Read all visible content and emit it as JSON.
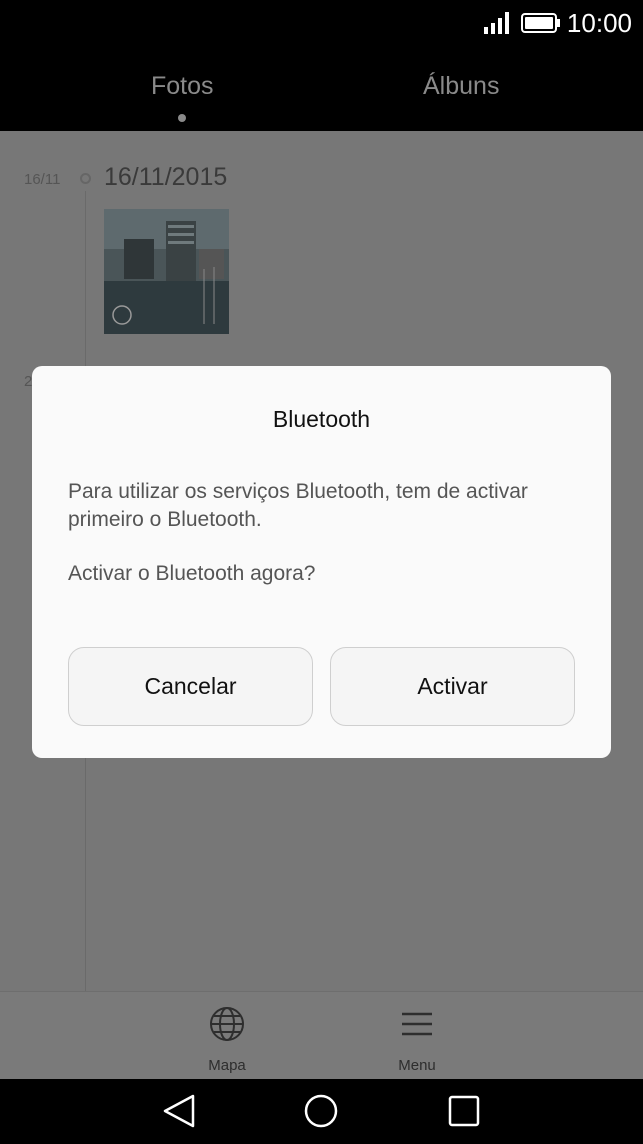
{
  "status_bar": {
    "time": "10:00",
    "icons": [
      "signal-icon",
      "battery-icon"
    ]
  },
  "tabs": [
    {
      "label": "Fotos",
      "selected": true
    },
    {
      "label": "Álbuns",
      "selected": false
    }
  ],
  "timeline": {
    "groups": [
      {
        "short_date": "16/11",
        "long_date": "16/11/2015"
      },
      {
        "short_date": "2"
      }
    ]
  },
  "dialog": {
    "title": "Bluetooth",
    "message": "Para utilizar os serviços Bluetooth, tem de activar primeiro o Bluetooth.",
    "question": "Activar o Bluetooth agora?",
    "cancel_label": "Cancelar",
    "confirm_label": "Activar"
  },
  "toolbar": {
    "items": [
      {
        "label": "Mapa",
        "icon": "globe-icon"
      },
      {
        "label": "Menu",
        "icon": "menu-icon"
      }
    ]
  },
  "navbar": {
    "icons": [
      "back-icon",
      "home-icon",
      "recent-apps-icon"
    ]
  },
  "colors": {
    "dim_overlay": "#777777",
    "dialog_bg": "#fafafa",
    "bars": "#000000"
  }
}
